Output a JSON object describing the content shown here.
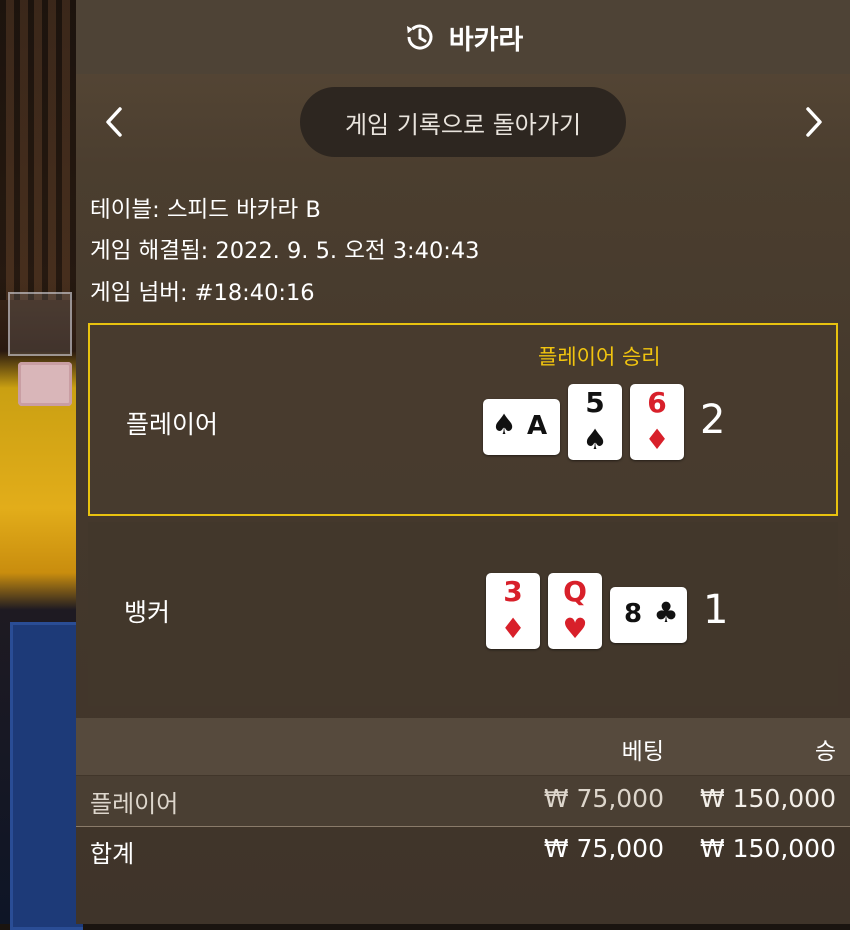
{
  "header": {
    "title": "바카라",
    "icon": "history-icon"
  },
  "nav": {
    "back_label": "게임 기록으로 돌아가기",
    "prev_icon": "chevron-left-icon",
    "next_icon": "chevron-right-icon"
  },
  "info": {
    "table": "테이블: 스피드 바카라 B",
    "resolved": "게임 해결됨: 2022. 9. 5. 오전 3:40:43",
    "number": "게임 넘버: #18:40:16"
  },
  "player": {
    "label": "플레이어",
    "win_text": "플레이어 승리",
    "score": "2",
    "cards": [
      {
        "rank": "A",
        "suit": "♠",
        "color": "black",
        "orientation": "side"
      },
      {
        "rank": "5",
        "suit": "♠",
        "color": "black",
        "orientation": "up"
      },
      {
        "rank": "6",
        "suit": "♦",
        "color": "red",
        "orientation": "up"
      }
    ]
  },
  "banker": {
    "label": "뱅커",
    "score": "1",
    "cards": [
      {
        "rank": "3",
        "suit": "♦",
        "color": "red",
        "orientation": "up"
      },
      {
        "rank": "Q",
        "suit": "♥",
        "color": "red",
        "orientation": "up"
      },
      {
        "rank": "8",
        "suit": "♣",
        "color": "black",
        "orientation": "side"
      }
    ]
  },
  "bets_table": {
    "headers": {
      "bet": "베팅",
      "win": "승"
    },
    "rows": [
      {
        "label": "플레이어",
        "bet": "₩ 75,000",
        "win": "₩ 150,000"
      },
      {
        "label": "합계",
        "bet": "₩ 75,000",
        "win": "₩ 150,000"
      }
    ]
  },
  "colors": {
    "accent_gold": "#e8c20f",
    "win_text": "#f1c40f",
    "card_red": "#d8202a"
  }
}
